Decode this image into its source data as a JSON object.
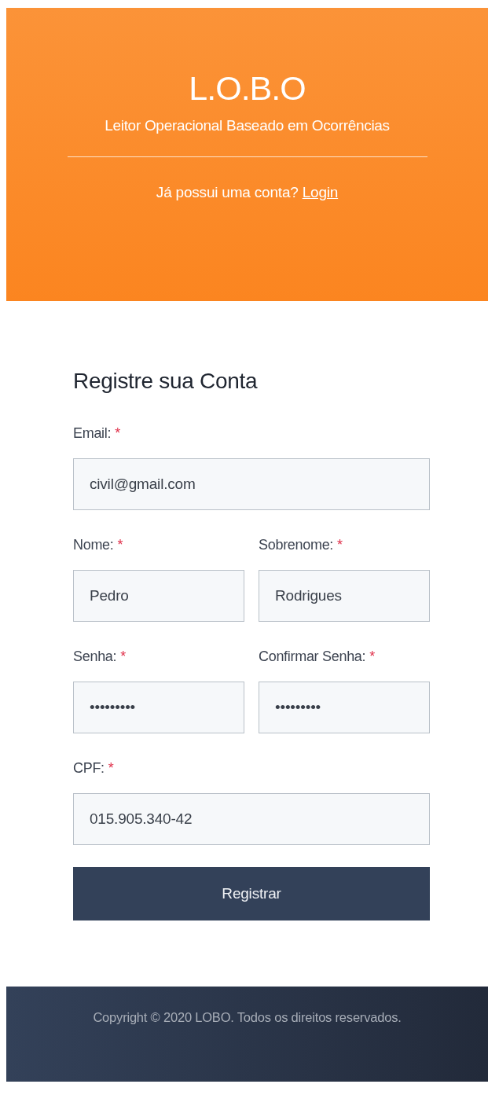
{
  "header": {
    "title": "L.O.B.O",
    "subtitle": "Leitor Operacional Baseado em Ocorrências",
    "login_prompt": "Já possui uma conta?",
    "login_link": "Login"
  },
  "form": {
    "heading": "Registre sua Conta",
    "rows": [
      [
        {
          "label": "Email:",
          "required_mark": "*",
          "value": "civil@gmail.com"
        }
      ],
      [
        {
          "label": "Nome:",
          "required_mark": "*",
          "value": "Pedro"
        },
        {
          "label": "Sobrenome:",
          "required_mark": "*",
          "value": "Rodrigues"
        }
      ],
      [
        {
          "label": "Senha:",
          "required_mark": "*",
          "value": "•••••••••"
        },
        {
          "label": "Confirmar Senha:",
          "required_mark": "*",
          "value": "•••••••••"
        }
      ],
      [
        {
          "label": "CPF:",
          "required_mark": "*",
          "value": "015.905.340-42"
        }
      ]
    ],
    "submit": "Registrar"
  },
  "footer": {
    "text": "Copyright © 2020 LOBO. Todos os direitos reservados."
  }
}
